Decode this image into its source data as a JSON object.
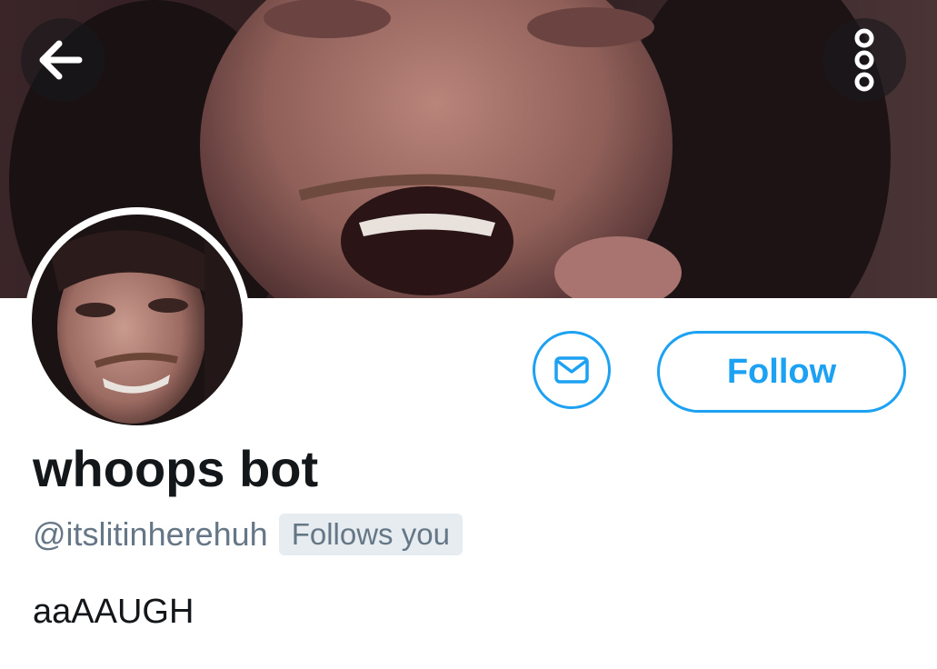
{
  "header": {
    "banner_image": "profile-banner-photo"
  },
  "nav": {
    "back_icon": "back-arrow-icon",
    "more_icon": "more-options-icon"
  },
  "profile": {
    "display_name": "whoops bot",
    "handle": "@itslitinherehuh",
    "follows_you_badge": "Follows you",
    "bio": "aaAAUGH",
    "avatar_image": "profile-avatar-photo"
  },
  "actions": {
    "message_icon": "envelope-icon",
    "follow_label": "Follow"
  },
  "colors": {
    "accent": "#1da1f2",
    "text_primary": "#14171a",
    "text_secondary": "#657786",
    "badge_bg": "#e6ecf0"
  }
}
